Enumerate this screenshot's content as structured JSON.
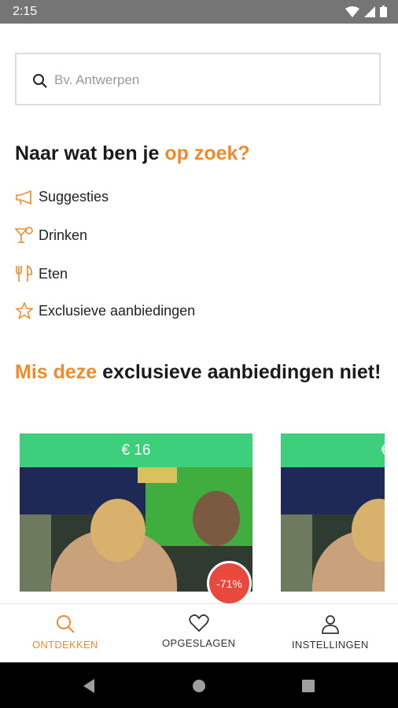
{
  "status_bar": {
    "time": "2:15"
  },
  "search": {
    "placeholder": "Bv. Antwerpen"
  },
  "section_search": {
    "title_prefix": "Naar wat ben je ",
    "title_accent": "op zoek?"
  },
  "categories": [
    {
      "label": "Suggesties",
      "icon": "megaphone-icon"
    },
    {
      "label": "Drinken",
      "icon": "cocktail-icon"
    },
    {
      "label": "Eten",
      "icon": "cutlery-icon"
    },
    {
      "label": "Exclusieve aanbiedingen",
      "icon": "star-icon"
    }
  ],
  "section_deals": {
    "title_accent": "Mis deze",
    "title_rest": " exclusieve aanbiedingen niet!"
  },
  "deals": [
    {
      "price": "€ 16",
      "discount": "-71%"
    },
    {
      "price": "€"
    }
  ],
  "bottom_nav": [
    {
      "label": "ONTDEKKEN",
      "icon": "search-icon",
      "active": true
    },
    {
      "label": "OPGESLAGEN",
      "icon": "heart-icon",
      "active": false
    },
    {
      "label": "INSTELLINGEN",
      "icon": "person-icon",
      "active": false
    }
  ],
  "colors": {
    "accent": "#ef8b2c",
    "price_bg": "#3ecf7c",
    "discount_bg": "#e8493c"
  }
}
